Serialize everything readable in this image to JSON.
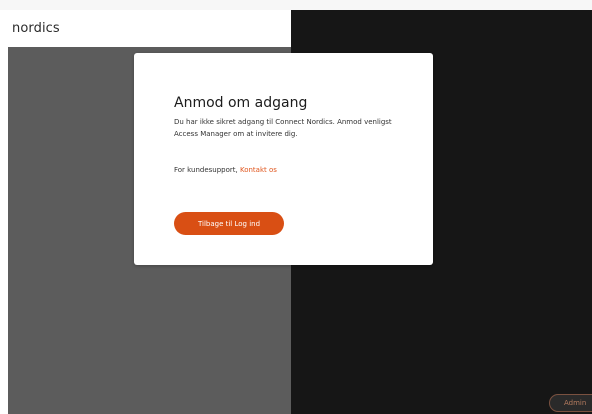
{
  "header": {
    "brand": "nordics"
  },
  "modal": {
    "title": "Anmod om adgang",
    "body": "Du har ikke sikret adgang til Connect Nordics. Anmod venligst Access Manager om at invitere dig.",
    "support_prefix": "For kundesupport, ",
    "support_link": "Kontakt os",
    "back_button": "Tilbage til Log ind"
  },
  "corner": {
    "admin_label": "Admin"
  },
  "colors": {
    "accent": "#d94f14",
    "link": "#e0561e",
    "gray_panel": "#5c5c5c",
    "dark_panel": "#161616"
  }
}
